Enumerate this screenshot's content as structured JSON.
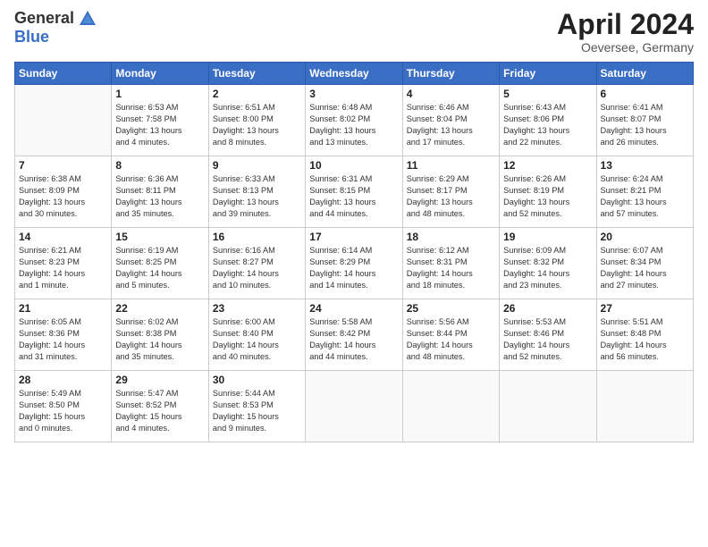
{
  "header": {
    "logo_general": "General",
    "logo_blue": "Blue",
    "month_title": "April 2024",
    "location": "Oeversee, Germany"
  },
  "days_of_week": [
    "Sunday",
    "Monday",
    "Tuesday",
    "Wednesday",
    "Thursday",
    "Friday",
    "Saturday"
  ],
  "weeks": [
    [
      {
        "day": "",
        "text": ""
      },
      {
        "day": "1",
        "text": "Sunrise: 6:53 AM\nSunset: 7:58 PM\nDaylight: 13 hours\nand 4 minutes."
      },
      {
        "day": "2",
        "text": "Sunrise: 6:51 AM\nSunset: 8:00 PM\nDaylight: 13 hours\nand 8 minutes."
      },
      {
        "day": "3",
        "text": "Sunrise: 6:48 AM\nSunset: 8:02 PM\nDaylight: 13 hours\nand 13 minutes."
      },
      {
        "day": "4",
        "text": "Sunrise: 6:46 AM\nSunset: 8:04 PM\nDaylight: 13 hours\nand 17 minutes."
      },
      {
        "day": "5",
        "text": "Sunrise: 6:43 AM\nSunset: 8:06 PM\nDaylight: 13 hours\nand 22 minutes."
      },
      {
        "day": "6",
        "text": "Sunrise: 6:41 AM\nSunset: 8:07 PM\nDaylight: 13 hours\nand 26 minutes."
      }
    ],
    [
      {
        "day": "7",
        "text": "Sunrise: 6:38 AM\nSunset: 8:09 PM\nDaylight: 13 hours\nand 30 minutes."
      },
      {
        "day": "8",
        "text": "Sunrise: 6:36 AM\nSunset: 8:11 PM\nDaylight: 13 hours\nand 35 minutes."
      },
      {
        "day": "9",
        "text": "Sunrise: 6:33 AM\nSunset: 8:13 PM\nDaylight: 13 hours\nand 39 minutes."
      },
      {
        "day": "10",
        "text": "Sunrise: 6:31 AM\nSunset: 8:15 PM\nDaylight: 13 hours\nand 44 minutes."
      },
      {
        "day": "11",
        "text": "Sunrise: 6:29 AM\nSunset: 8:17 PM\nDaylight: 13 hours\nand 48 minutes."
      },
      {
        "day": "12",
        "text": "Sunrise: 6:26 AM\nSunset: 8:19 PM\nDaylight: 13 hours\nand 52 minutes."
      },
      {
        "day": "13",
        "text": "Sunrise: 6:24 AM\nSunset: 8:21 PM\nDaylight: 13 hours\nand 57 minutes."
      }
    ],
    [
      {
        "day": "14",
        "text": "Sunrise: 6:21 AM\nSunset: 8:23 PM\nDaylight: 14 hours\nand 1 minute."
      },
      {
        "day": "15",
        "text": "Sunrise: 6:19 AM\nSunset: 8:25 PM\nDaylight: 14 hours\nand 5 minutes."
      },
      {
        "day": "16",
        "text": "Sunrise: 6:16 AM\nSunset: 8:27 PM\nDaylight: 14 hours\nand 10 minutes."
      },
      {
        "day": "17",
        "text": "Sunrise: 6:14 AM\nSunset: 8:29 PM\nDaylight: 14 hours\nand 14 minutes."
      },
      {
        "day": "18",
        "text": "Sunrise: 6:12 AM\nSunset: 8:31 PM\nDaylight: 14 hours\nand 18 minutes."
      },
      {
        "day": "19",
        "text": "Sunrise: 6:09 AM\nSunset: 8:32 PM\nDaylight: 14 hours\nand 23 minutes."
      },
      {
        "day": "20",
        "text": "Sunrise: 6:07 AM\nSunset: 8:34 PM\nDaylight: 14 hours\nand 27 minutes."
      }
    ],
    [
      {
        "day": "21",
        "text": "Sunrise: 6:05 AM\nSunset: 8:36 PM\nDaylight: 14 hours\nand 31 minutes."
      },
      {
        "day": "22",
        "text": "Sunrise: 6:02 AM\nSunset: 8:38 PM\nDaylight: 14 hours\nand 35 minutes."
      },
      {
        "day": "23",
        "text": "Sunrise: 6:00 AM\nSunset: 8:40 PM\nDaylight: 14 hours\nand 40 minutes."
      },
      {
        "day": "24",
        "text": "Sunrise: 5:58 AM\nSunset: 8:42 PM\nDaylight: 14 hours\nand 44 minutes."
      },
      {
        "day": "25",
        "text": "Sunrise: 5:56 AM\nSunset: 8:44 PM\nDaylight: 14 hours\nand 48 minutes."
      },
      {
        "day": "26",
        "text": "Sunrise: 5:53 AM\nSunset: 8:46 PM\nDaylight: 14 hours\nand 52 minutes."
      },
      {
        "day": "27",
        "text": "Sunrise: 5:51 AM\nSunset: 8:48 PM\nDaylight: 14 hours\nand 56 minutes."
      }
    ],
    [
      {
        "day": "28",
        "text": "Sunrise: 5:49 AM\nSunset: 8:50 PM\nDaylight: 15 hours\nand 0 minutes."
      },
      {
        "day": "29",
        "text": "Sunrise: 5:47 AM\nSunset: 8:52 PM\nDaylight: 15 hours\nand 4 minutes."
      },
      {
        "day": "30",
        "text": "Sunrise: 5:44 AM\nSunset: 8:53 PM\nDaylight: 15 hours\nand 9 minutes."
      },
      {
        "day": "",
        "text": ""
      },
      {
        "day": "",
        "text": ""
      },
      {
        "day": "",
        "text": ""
      },
      {
        "day": "",
        "text": ""
      }
    ]
  ]
}
